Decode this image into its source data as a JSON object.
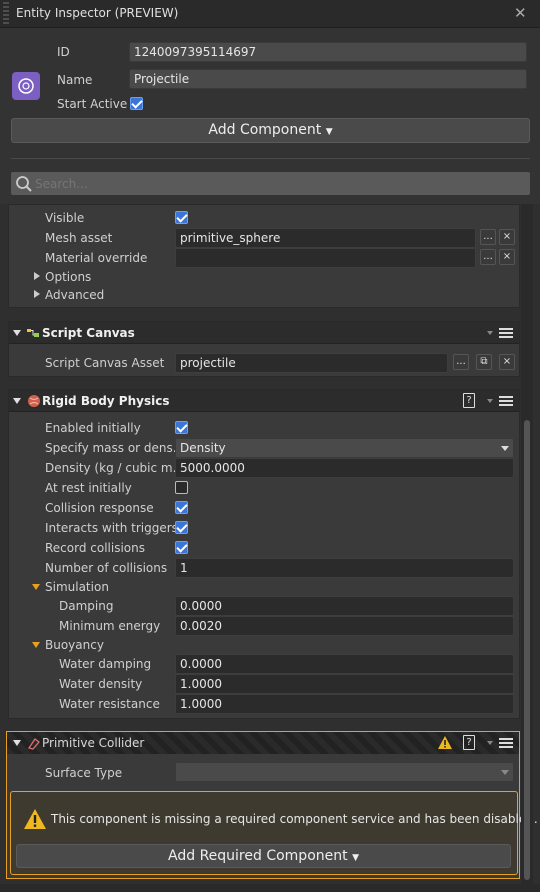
{
  "window": {
    "title": "Entity Inspector (PREVIEW)"
  },
  "entity": {
    "id_label": "ID",
    "id_value": "1240097395114697",
    "name_label": "Name",
    "name_value": "Projectile",
    "start_active_label": "Start Active",
    "start_active": true
  },
  "add_component_label": "Add Component",
  "search": {
    "placeholder": "Search..."
  },
  "mesh": {
    "visible_label": "Visible",
    "mesh_asset_label": "Mesh asset",
    "mesh_asset_value": "primitive_sphere",
    "material_override_label": "Material override",
    "material_override_value": "",
    "options_label": "Options",
    "advanced_label": "Advanced",
    "browse_label": "...",
    "clear_label": "×"
  },
  "script_canvas": {
    "header": "Script Canvas",
    "asset_label": "Script Canvas Asset",
    "asset_value": "projectile",
    "browse_label": "...",
    "clear_label": "×"
  },
  "rigid_body": {
    "header": "Rigid Body Physics",
    "help_label": "?",
    "enabled_label": "Enabled initially",
    "mass_label": "Specify mass or dens...",
    "mass_value": "Density",
    "density_label": "Density (kg / cubic m...",
    "density_value": "5000.0000",
    "at_rest_label": "At rest initially",
    "collision_response_label": "Collision response",
    "interacts_label": "Interacts with triggers",
    "record_label": "Record collisions",
    "num_collisions_label": "Number of collisions",
    "num_collisions_value": "1",
    "simulation_label": "Simulation",
    "damping_label": "Damping",
    "damping_value": "0.0000",
    "min_energy_label": "Minimum energy",
    "min_energy_value": "0.0020",
    "buoyancy_label": "Buoyancy",
    "water_damping_label": "Water damping",
    "water_damping_value": "0.0000",
    "water_density_label": "Water density",
    "water_density_value": "1.0000",
    "water_resistance_label": "Water resistance",
    "water_resistance_value": "1.0000"
  },
  "primitive_collider": {
    "header": "Primitive Collider",
    "help_label": "?",
    "surface_type_label": "Surface Type",
    "surface_type_value": "",
    "warning_text": "This component is missing a required component service and has been disabled.",
    "add_required_label": "Add Required Component"
  },
  "colors": {
    "accent_blue": "#3a76d8",
    "warning_orange": "#e8a020"
  }
}
